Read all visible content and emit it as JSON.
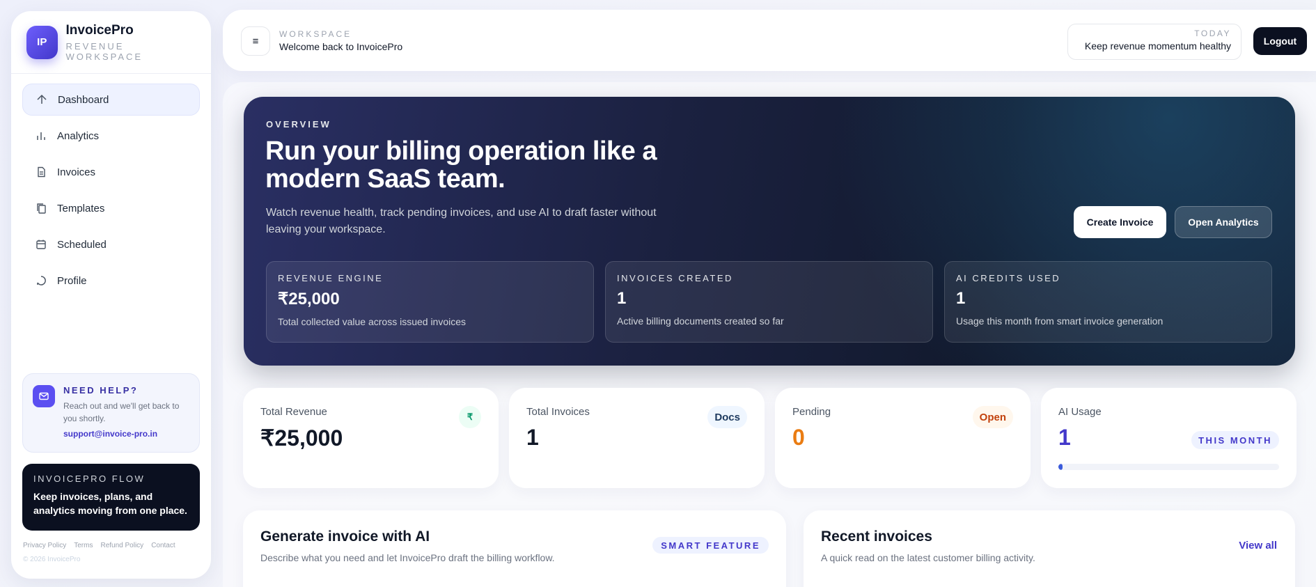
{
  "brand": {
    "logo_text": "IP",
    "name": "InvoicePro",
    "subtitle": "REVENUE WORKSPACE"
  },
  "sidebar": {
    "items": [
      {
        "label": "Dashboard",
        "icon": "dashboard-icon",
        "active": true
      },
      {
        "label": "Analytics",
        "icon": "bar-chart-icon"
      },
      {
        "label": "Invoices",
        "icon": "document-icon"
      },
      {
        "label": "Templates",
        "icon": "copy-icon"
      },
      {
        "label": "Scheduled",
        "icon": "calendar-icon"
      },
      {
        "label": "Profile",
        "icon": "user-circle-icon"
      }
    ]
  },
  "help": {
    "title": "NEED HELP?",
    "text": "Reach out and we'll get back to you shortly.",
    "email": "support@invoice-pro.in",
    "icon": "mail-icon"
  },
  "flow": {
    "title": "INVOICEPRO FLOW",
    "text": "Keep invoices, plans, and analytics moving from one place."
  },
  "footer": {
    "links": [
      "Privacy Policy",
      "Terms",
      "Refund Policy",
      "Contact"
    ],
    "copyright": "© 2026 InvoicePro"
  },
  "topbar": {
    "menu_icon": "≡",
    "workspace_label": "WORKSPACE",
    "welcome": "Welcome back to InvoicePro",
    "today_label": "TODAY",
    "today_text": "Keep revenue momentum healthy",
    "logout_label": "Logout"
  },
  "hero": {
    "eyebrow": "OVERVIEW",
    "title": "Run your billing operation like a modern SaaS team.",
    "description": "Watch revenue health, track pending invoices, and use AI to draft faster without leaving your workspace.",
    "create_label": "Create Invoice",
    "analytics_label": "Open Analytics",
    "stats": [
      {
        "label": "REVENUE ENGINE",
        "value": "₹25,000",
        "desc": "Total collected value across issued invoices"
      },
      {
        "label": "INVOICES CREATED",
        "value": "1",
        "desc": "Active billing documents created so far"
      },
      {
        "label": "AI CREDITS USED",
        "value": "1",
        "desc": "Usage this month from smart invoice generation"
      }
    ]
  },
  "kpis": [
    {
      "label": "Total Revenue",
      "value": "₹25,000",
      "badge": "₹"
    },
    {
      "label": "Total Invoices",
      "value": "1",
      "badge": "Docs"
    },
    {
      "label": "Pending",
      "value": "0",
      "badge": "Open"
    },
    {
      "label": "AI Usage",
      "value": "1",
      "badge": "THIS MONTH",
      "progress": 0.02
    }
  ],
  "colors": {
    "accent": "#4f46e5",
    "pending": "#ea7c12",
    "ai": "#4338ca",
    "dark": "#0b1020"
  },
  "panels": {
    "ai": {
      "title": "Generate invoice with AI",
      "subtitle": "Describe what you need and let InvoicePro draft the billing workflow.",
      "badge": "SMART FEATURE"
    },
    "recent": {
      "title": "Recent invoices",
      "subtitle": "A quick read on the latest customer billing activity.",
      "link": "View all"
    }
  }
}
